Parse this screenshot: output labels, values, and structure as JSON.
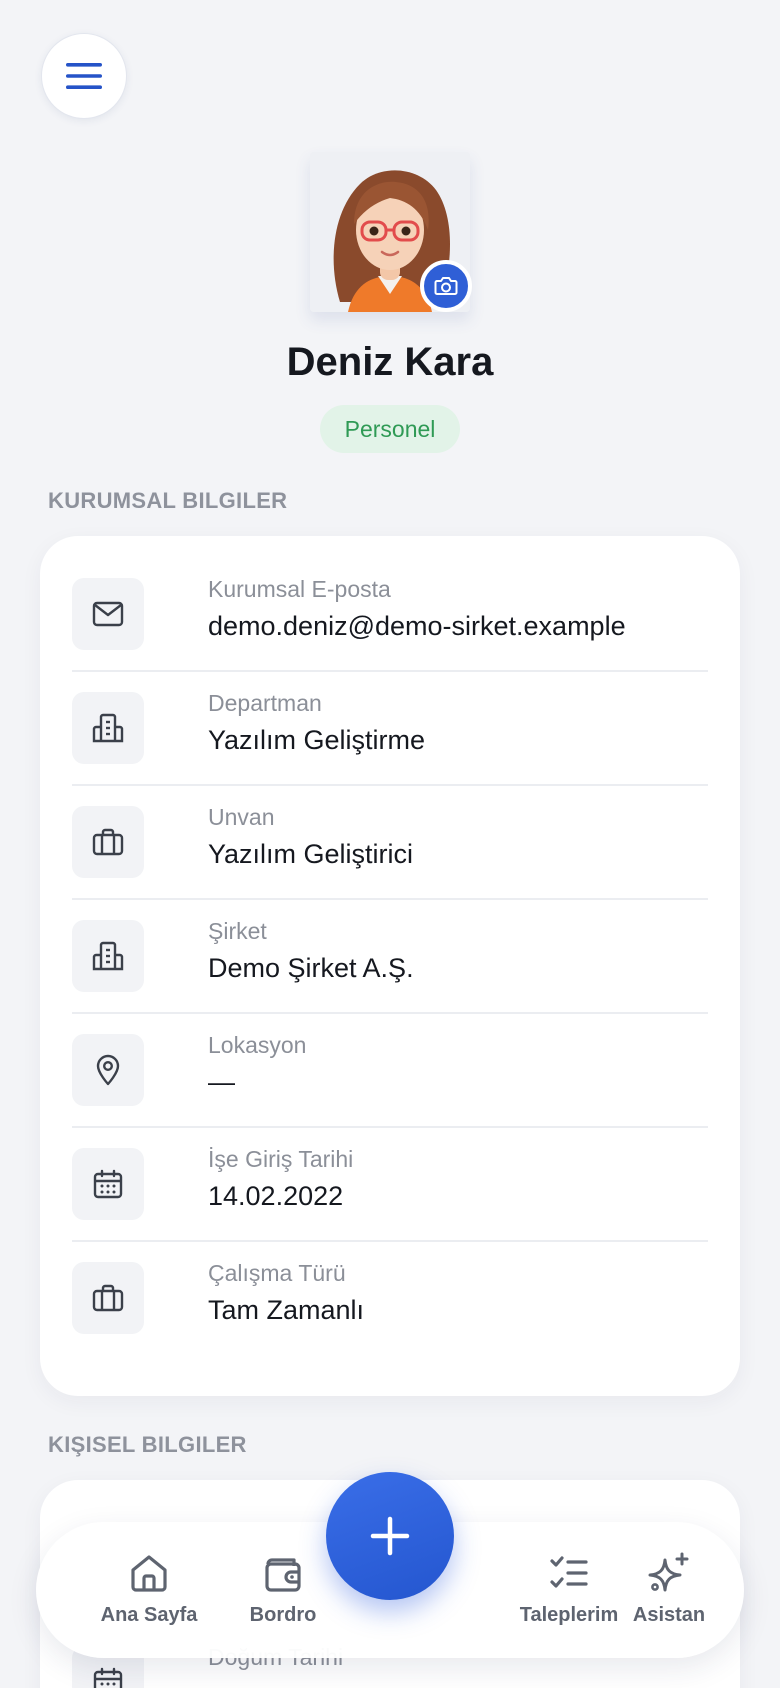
{
  "profile": {
    "name": "Deniz Kara",
    "role": "Personel"
  },
  "corporate": {
    "title": "KURUMSAL BILGILER",
    "fields": [
      {
        "label": "Kurumsal E-posta",
        "value": "demo.deniz@demo-sirket.example",
        "icon": "mail-icon"
      },
      {
        "label": "Departman",
        "value": "Yazılım Geliştirme",
        "icon": "building-icon"
      },
      {
        "label": "Unvan",
        "value": "Yazılım Geliştirici",
        "icon": "briefcase-icon"
      },
      {
        "label": "Şirket",
        "value": "Demo Şirket A.Ş.",
        "icon": "building-icon"
      },
      {
        "label": "Lokasyon",
        "value": "—",
        "icon": "map-pin-icon"
      },
      {
        "label": "İşe Giriş Tarihi",
        "value": "14.02.2022",
        "icon": "calendar-icon"
      },
      {
        "label": "Çalışma Türü",
        "value": "Tam Zamanlı",
        "icon": "briefcase-icon"
      }
    ]
  },
  "personal": {
    "title": "KIŞISEL BILGILER",
    "fields": [
      {
        "label": "Doğum Tarihi",
        "icon": "calendar-icon"
      }
    ]
  },
  "nav": {
    "items": [
      {
        "label": "Ana Sayfa",
        "icon": "home-icon"
      },
      {
        "label": "Bordro",
        "icon": "wallet-icon"
      },
      {
        "label": "Taleplerim",
        "icon": "checklist-icon"
      },
      {
        "label": "Asistan",
        "icon": "sparkles-icon"
      }
    ],
    "fab_icon": "plus-icon"
  },
  "colors": {
    "accent": "#2f5fd6",
    "badge_bg": "#e2f3e8",
    "badge_text": "#2f9a55",
    "background": "#f3f4f7"
  }
}
